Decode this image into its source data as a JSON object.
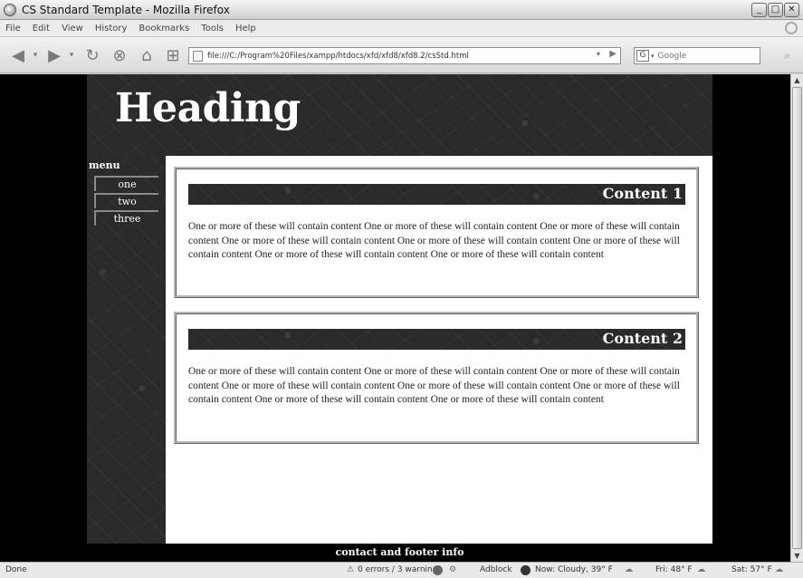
{
  "window": {
    "title": "CS Standard Template - Mozilla Firefox",
    "controls": [
      "_",
      "□",
      "✕"
    ]
  },
  "menubar": [
    "File",
    "Edit",
    "View",
    "History",
    "Bookmarks",
    "Tools",
    "Help"
  ],
  "toolbar": {
    "url": "file:///C:/Program%20Files/xampp/htdocs/xfd/xfd8/xfd8.2/csStd.html",
    "search_placeholder": "Google",
    "search_engine_glyph": "G"
  },
  "page": {
    "heading": "Heading",
    "menu_title": "menu",
    "menu_items": [
      "one",
      "two",
      "three"
    ],
    "content_boxes": [
      {
        "title": "Content 1",
        "text": "One or more of these will contain content One or more of these will contain content One or more of these will contain content One or more of these will contain content One or more of these will contain content One or more of these will contain content One or more of these will contain content One or more of these will contain content"
      },
      {
        "title": "Content 2",
        "text": "One or more of these will contain content One or more of these will contain content One or more of these will contain content One or more of these will contain content One or more of these will contain content One or more of these will contain content One or more of these will contain content One or more of these will contain content"
      }
    ],
    "footer": "contact and footer info"
  },
  "statusbar": {
    "status": "Done",
    "errors": "0 errors / 3 warnings",
    "adblock": "Adblock",
    "weather_now": "Now: Cloudy, 39° F",
    "weather_fri": "Fri: 48° F",
    "weather_sat": "Sat: 57° F"
  },
  "colors": {
    "page_background": "#000000",
    "content_background": "#ffffff",
    "circuit_dark": "#2a2a2a"
  }
}
